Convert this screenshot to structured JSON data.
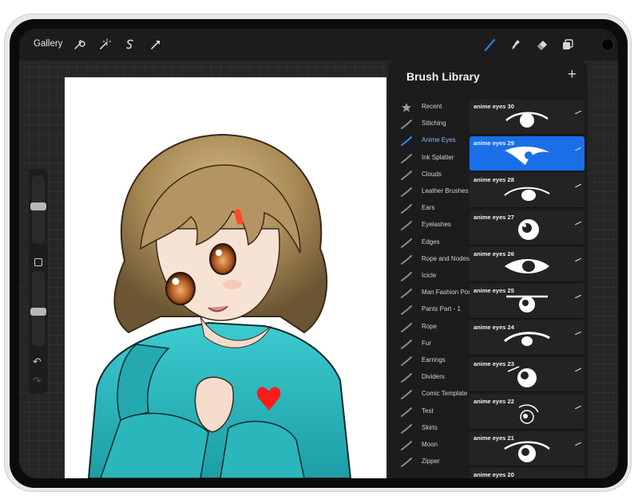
{
  "topbar": {
    "gallery_label": "Gallery",
    "left_tools": [
      "wrench-icon",
      "magic-wand-icon",
      "selection-icon",
      "transform-icon"
    ],
    "right_tools": [
      "brush-icon",
      "smudge-icon",
      "eraser-icon",
      "layers-icon"
    ],
    "active_color": "#000000"
  },
  "sidebar": {
    "size_level": 0.55,
    "opacity_level": 0.45,
    "undo_icon": "undo-icon",
    "redo_icon": "redo-icon"
  },
  "library": {
    "title": "Brush Library",
    "add_icon": "plus-icon",
    "brush_sets": [
      {
        "label": "Recent",
        "icon": "star-icon",
        "active": false
      },
      {
        "label": "Stitching",
        "icon": "brush-stroke-icon",
        "active": false
      },
      {
        "label": "Anime Eyes",
        "icon": "brush-stroke-icon",
        "active": true
      },
      {
        "label": "Ink Splatter",
        "icon": "brush-stroke-icon",
        "active": false
      },
      {
        "label": "Clouds",
        "icon": "brush-stroke-icon",
        "active": false
      },
      {
        "label": "Leather Brushes",
        "icon": "brush-stroke-icon",
        "active": false
      },
      {
        "label": "Ears",
        "icon": "brush-stroke-icon",
        "active": false
      },
      {
        "label": "Eyelashes",
        "icon": "brush-stroke-icon",
        "active": false
      },
      {
        "label": "Edges",
        "icon": "brush-stroke-icon",
        "active": false
      },
      {
        "label": "Rope and Nodes",
        "icon": "brush-stroke-icon",
        "active": false
      },
      {
        "label": "Icicle",
        "icon": "brush-stroke-icon",
        "active": false
      },
      {
        "label": "Man Fashion Poses",
        "icon": "brush-stroke-icon",
        "active": false
      },
      {
        "label": "Pants Part - 1",
        "icon": "brush-stroke-icon",
        "active": false
      },
      {
        "label": "Rope",
        "icon": "brush-stroke-icon",
        "active": false
      },
      {
        "label": "Fur",
        "icon": "brush-stroke-icon",
        "active": false
      },
      {
        "label": "Earrings",
        "icon": "brush-stroke-icon",
        "active": false
      },
      {
        "label": "Dividers",
        "icon": "brush-stroke-icon",
        "active": false
      },
      {
        "label": "Comic Template",
        "icon": "brush-stroke-icon",
        "active": false
      },
      {
        "label": "Test",
        "icon": "brush-stroke-icon",
        "active": false
      },
      {
        "label": "Skirts",
        "icon": "brush-stroke-icon",
        "active": false
      },
      {
        "label": "Moon",
        "icon": "brush-stroke-icon",
        "active": false
      },
      {
        "label": "Zipper",
        "icon": "brush-stroke-icon",
        "active": false
      }
    ],
    "brushes": [
      {
        "name": "anime eyes 30",
        "active": false
      },
      {
        "name": "anime eyes 29",
        "active": true
      },
      {
        "name": "anime eyes 28",
        "active": false
      },
      {
        "name": "anime eyes 27",
        "active": false
      },
      {
        "name": "anime eyes 26",
        "active": false
      },
      {
        "name": "anime eyes 25",
        "active": false
      },
      {
        "name": "anime eyes 24",
        "active": false
      },
      {
        "name": "anime eyes 23",
        "active": false
      },
      {
        "name": "anime eyes 22",
        "active": false
      },
      {
        "name": "anime eyes 21",
        "active": false
      },
      {
        "name": "anime eyes 20",
        "active": false
      }
    ],
    "accent_color": "#1a6fe8"
  },
  "artwork": {
    "hair_color": "#a88a55",
    "hoodie_color": "#2ab5bb",
    "heart_color": "#ff1a1a"
  }
}
